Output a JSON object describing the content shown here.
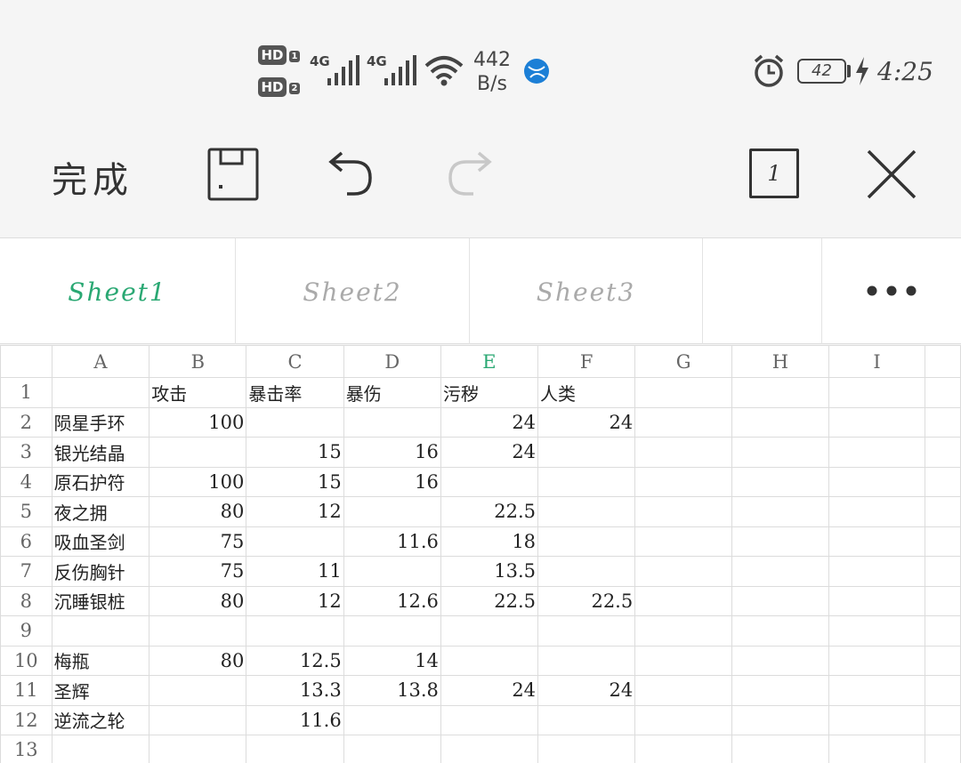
{
  "status_bar": {
    "hd1": "HD",
    "hd1_num": "1",
    "hd2": "HD",
    "hd2_num": "2",
    "net1": "4G",
    "net2": "4G",
    "speed_value": "442",
    "speed_unit": "B/s",
    "battery": "42",
    "time": "4:25",
    "icons": [
      "signal-icon",
      "wifi-icon",
      "browser-globe-icon",
      "alarm-icon",
      "battery-icon",
      "charging-icon"
    ]
  },
  "toolbar": {
    "done_label": "完成",
    "page_indicator": "1",
    "icons": [
      "save-icon",
      "undo-icon",
      "redo-icon",
      "close-icon"
    ]
  },
  "tabs": [
    {
      "label": "Sheet1",
      "active": true
    },
    {
      "label": "Sheet2",
      "active": false
    },
    {
      "label": "Sheet3",
      "active": false
    }
  ],
  "colors": {
    "accent": "#2aa873",
    "grid": "#dcdcdc"
  },
  "sheet": {
    "columns": [
      "A",
      "B",
      "C",
      "D",
      "E",
      "F",
      "G",
      "H",
      "I"
    ],
    "selected_column": "E",
    "rows": [
      {
        "n": "1",
        "cells": [
          "",
          "攻击",
          "暴击率",
          "暴伤",
          "污秽",
          "人类",
          "",
          "",
          ""
        ]
      },
      {
        "n": "2",
        "cells": [
          "陨星手环",
          "100",
          "",
          "",
          "24",
          "24",
          "",
          "",
          ""
        ]
      },
      {
        "n": "3",
        "cells": [
          "银光结晶",
          "",
          "15",
          "16",
          "24",
          "",
          "",
          "",
          ""
        ]
      },
      {
        "n": "4",
        "cells": [
          "原石护符",
          "100",
          "15",
          "16",
          "",
          "",
          "",
          "",
          ""
        ]
      },
      {
        "n": "5",
        "cells": [
          "夜之拥",
          "80",
          "12",
          "",
          "22.5",
          "",
          "",
          "",
          ""
        ]
      },
      {
        "n": "6",
        "cells": [
          "吸血圣剑",
          "75",
          "",
          "11.6",
          "18",
          "",
          "",
          "",
          ""
        ]
      },
      {
        "n": "7",
        "cells": [
          "反伤胸针",
          "75",
          "11",
          "",
          "13.5",
          "",
          "",
          "",
          ""
        ]
      },
      {
        "n": "8",
        "cells": [
          "沉睡银桩",
          "80",
          "12",
          "12.6",
          "22.5",
          "22.5",
          "",
          "",
          ""
        ]
      },
      {
        "n": "9",
        "cells": [
          "",
          "",
          "",
          "",
          "",
          "",
          "",
          "",
          ""
        ]
      },
      {
        "n": "10",
        "cells": [
          "梅瓶",
          "80",
          "12.5",
          "14",
          "",
          "",
          "",
          "",
          ""
        ]
      },
      {
        "n": "11",
        "cells": [
          "圣辉",
          "",
          "13.3",
          "13.8",
          "24",
          "24",
          "",
          "",
          ""
        ]
      },
      {
        "n": "12",
        "cells": [
          "逆流之轮",
          "",
          "11.6",
          "",
          "",
          "",
          "",
          "",
          ""
        ]
      },
      {
        "n": "13",
        "cells": [
          "",
          "",
          "",
          "",
          "",
          "",
          "",
          "",
          ""
        ]
      }
    ]
  }
}
